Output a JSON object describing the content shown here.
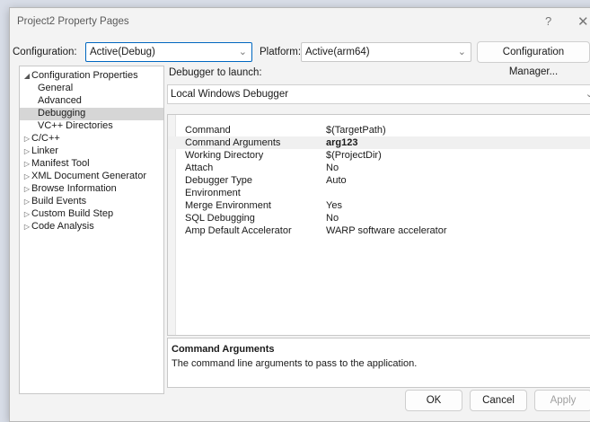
{
  "window": {
    "title": "Project2 Property Pages",
    "help": "?",
    "close": "✕"
  },
  "config": {
    "configuration_label": "Configuration:",
    "configuration_value": "Active(Debug)",
    "platform_label": "Platform:",
    "platform_value": "Active(arm64)",
    "manager_button": "Configuration Manager..."
  },
  "tree": {
    "items": [
      {
        "label": "Configuration Properties",
        "expander": "◢",
        "indent": 0
      },
      {
        "label": "General",
        "expander": "",
        "indent": 1
      },
      {
        "label": "Advanced",
        "expander": "",
        "indent": 1
      },
      {
        "label": "Debugging",
        "expander": "",
        "indent": 1,
        "selected": true
      },
      {
        "label": "VC++ Directories",
        "expander": "",
        "indent": 1
      },
      {
        "label": "C/C++",
        "expander": "▷",
        "indent": 0
      },
      {
        "label": "Linker",
        "expander": "▷",
        "indent": 0
      },
      {
        "label": "Manifest Tool",
        "expander": "▷",
        "indent": 0
      },
      {
        "label": "XML Document Generator",
        "expander": "▷",
        "indent": 0
      },
      {
        "label": "Browse Information",
        "expander": "▷",
        "indent": 0
      },
      {
        "label": "Build Events",
        "expander": "▷",
        "indent": 0
      },
      {
        "label": "Custom Build Step",
        "expander": "▷",
        "indent": 0
      },
      {
        "label": "Code Analysis",
        "expander": "▷",
        "indent": 0
      }
    ]
  },
  "debugger": {
    "label": "Debugger to launch:",
    "value": "Local Windows Debugger"
  },
  "properties": [
    {
      "name": "Command",
      "value": "$(TargetPath)"
    },
    {
      "name": "Command Arguments",
      "value": "arg123",
      "bold": true,
      "selected": true
    },
    {
      "name": "Working Directory",
      "value": "$(ProjectDir)"
    },
    {
      "name": "Attach",
      "value": "No"
    },
    {
      "name": "Debugger Type",
      "value": "Auto"
    },
    {
      "name": "Environment",
      "value": ""
    },
    {
      "name": "Merge Environment",
      "value": "Yes"
    },
    {
      "name": "SQL Debugging",
      "value": "No"
    },
    {
      "name": "Amp Default Accelerator",
      "value": "WARP software accelerator"
    }
  ],
  "description": {
    "title": "Command Arguments",
    "text": "The command line arguments to pass to the application."
  },
  "buttons": {
    "ok": "OK",
    "cancel": "Cancel",
    "apply": "Apply"
  },
  "icons": {
    "chevron": "⌄"
  }
}
